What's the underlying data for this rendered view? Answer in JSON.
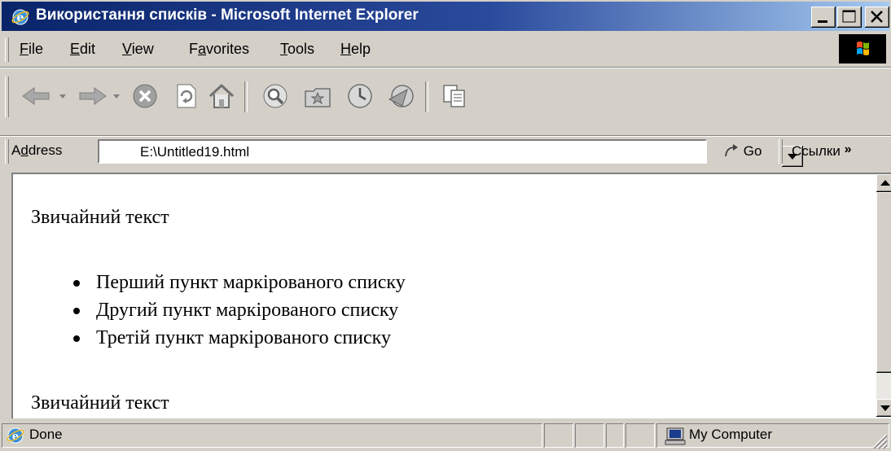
{
  "window": {
    "title": "Використання списків - Microsoft Internet Explorer"
  },
  "menu": [
    {
      "label": "File",
      "accel_index": 0
    },
    {
      "label": "Edit",
      "accel_index": 0
    },
    {
      "label": "View",
      "accel_index": 0
    },
    {
      "label": "Favorites",
      "accel_index": 1
    },
    {
      "label": "Tools",
      "accel_index": 0
    },
    {
      "label": "Help",
      "accel_index": 0
    }
  ],
  "toolbar": {
    "buttons": [
      "back-icon",
      "forward-icon",
      "stop-icon",
      "refresh-icon",
      "home-icon",
      "search-icon",
      "favorites-icon",
      "history-icon",
      "mail-icon",
      "edit-icon"
    ]
  },
  "address": {
    "label": "Address",
    "value": "E:\\Untitled19.html",
    "go_label": "Go",
    "links_label": "Ссылки",
    "links_chevron": "»"
  },
  "content": {
    "paragraph1": "Звичайний текст",
    "list_items": [
      "Перший пункт маркірованого списку",
      "Другий пункт маркірованого списку",
      "Третій пункт маркірованого списку"
    ],
    "paragraph2": "Звичайний текст"
  },
  "status": {
    "text": "Done",
    "zone": "My Computer"
  },
  "colors": {
    "titlebar_start": "#0a246a",
    "titlebar_end": "#a6caf0",
    "chrome": "#d4d0c8"
  }
}
